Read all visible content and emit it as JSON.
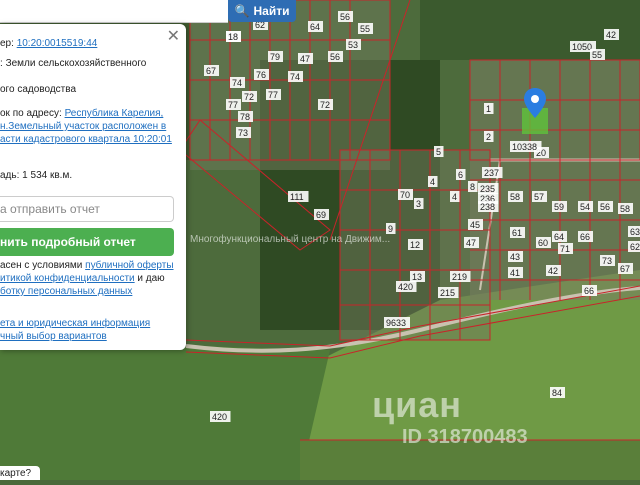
{
  "search": {
    "button_label": "Найти"
  },
  "panel": {
    "cadastral_label": "ер:",
    "cadastral_number": "10:20:0015519:44",
    "category_prefix": ":",
    "category_value": "Земли сельскохозяйственного",
    "use_value": "ого садоводства",
    "address_label": "ок по адресу:",
    "address_line1": "Республика Карелия,",
    "address_line2": "н.Земельный участок расположен в",
    "address_line3": "асти кадастрового квартала 10:20:01",
    "area_label": "адь:",
    "area_value": "1 534 кв.м.",
    "phone_placeholder": "а отправить отчет",
    "report_button": "нить подробный отчет",
    "agree_prefix": "асен с условиями",
    "agree_link1": "публичной оферты",
    "agree_link2": "итикой конфиденциальности",
    "agree_mid": "и даю",
    "agree_link3": "ботку персональных данных",
    "footer_link1": "ета и юридическая информация",
    "footer_link2": "чный выбор вариантов"
  },
  "map": {
    "overlay_text": "Многофункциональный центр на Движим...",
    "watermark_logo": "циан",
    "watermark_id": "ID 318700483",
    "bottom_question": "карте?",
    "plots": [
      "59",
      "62",
      "64",
      "56",
      "55",
      "53",
      "56",
      "76",
      "72",
      "74",
      "47",
      "79",
      "77",
      "78",
      "72",
      "77",
      "74",
      "73",
      "67",
      "111",
      "69",
      "1050",
      "55",
      "42",
      "1",
      "2",
      "5",
      "20",
      "10338",
      "8",
      "4",
      "6",
      "237",
      "235",
      "236",
      "238",
      "3",
      "4",
      "70",
      "9",
      "12",
      "13",
      "215",
      "219",
      "47",
      "45",
      "43",
      "41",
      "42",
      "58",
      "57",
      "59",
      "54",
      "56",
      "58",
      "64",
      "66",
      "61",
      "60",
      "71",
      "73",
      "67",
      "62",
      "63",
      "66",
      "84",
      "420",
      "420",
      "9633",
      "18"
    ]
  },
  "colors": {
    "plot_border": "#c8242a",
    "green_button": "#4caf50",
    "link_blue": "#1f6fc0",
    "search_blue": "#2e6db4",
    "marker_blue": "#2a7de1"
  }
}
